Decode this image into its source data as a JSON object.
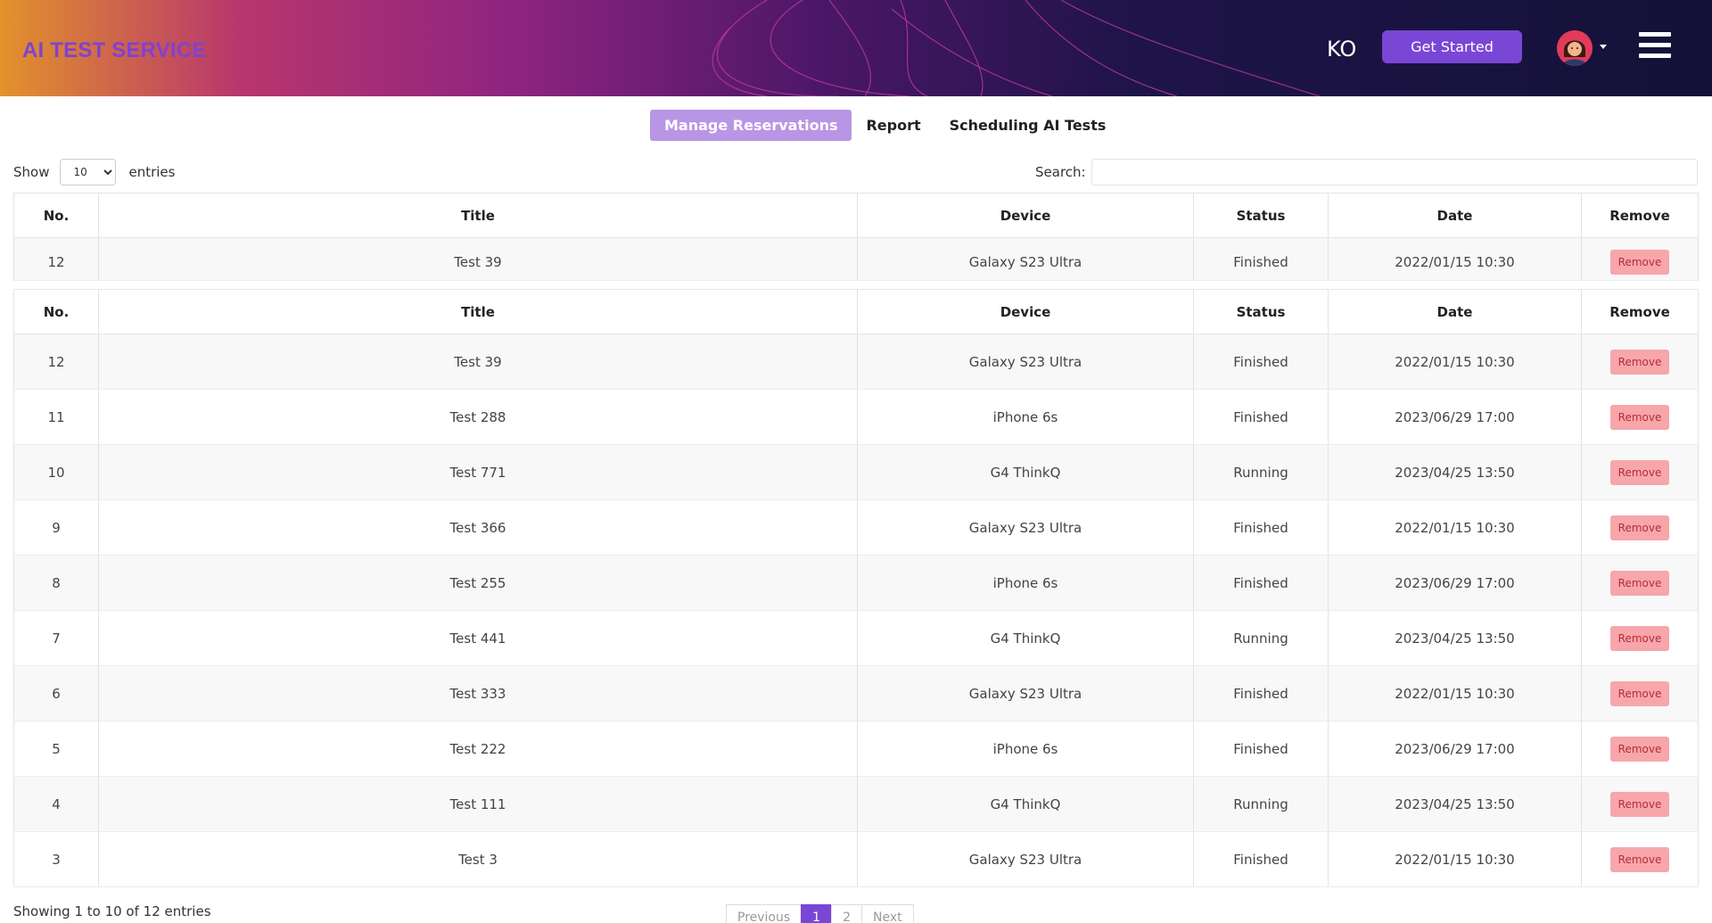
{
  "header": {
    "logo": "AI TEST SERVICE",
    "lang": "KO",
    "cta": "Get Started",
    "icons": {
      "avatar": "user-avatar-icon",
      "menu": "hamburger-menu-icon"
    }
  },
  "tabs": [
    {
      "label": "Manage Reservations",
      "active": true
    },
    {
      "label": "Report",
      "active": false
    },
    {
      "label": "Scheduling AI Tests",
      "active": false
    }
  ],
  "controls": {
    "show_label": "Show",
    "entries_label": "entries",
    "page_size": "10",
    "search_label": "Search:"
  },
  "table": {
    "columns": [
      "No.",
      "Title",
      "Device",
      "Status",
      "Date",
      "Remove"
    ],
    "remove_label": "Remove",
    "rows": [
      {
        "no": "12",
        "title": "Test 39",
        "device": "Galaxy S23 Ultra",
        "status": "Finished",
        "date": "2022/01/15 10:30"
      },
      {
        "no": "11",
        "title": "Test 288",
        "device": "iPhone 6s",
        "status": "Finished",
        "date": "2023/06/29 17:00"
      },
      {
        "no": "10",
        "title": "Test 771",
        "device": "G4 ThinkQ",
        "status": "Running",
        "date": "2023/04/25 13:50"
      },
      {
        "no": "9",
        "title": "Test 366",
        "device": "Galaxy S23 Ultra",
        "status": "Finished",
        "date": "2022/01/15 10:30"
      },
      {
        "no": "8",
        "title": "Test 255",
        "device": "iPhone 6s",
        "status": "Finished",
        "date": "2023/06/29 17:00"
      },
      {
        "no": "7",
        "title": "Test 441",
        "device": "G4 ThinkQ",
        "status": "Running",
        "date": "2023/04/25 13:50"
      },
      {
        "no": "6",
        "title": "Test 333",
        "device": "Galaxy S23 Ultra",
        "status": "Finished",
        "date": "2022/01/15 10:30"
      },
      {
        "no": "5",
        "title": "Test 222",
        "device": "iPhone 6s",
        "status": "Finished",
        "date": "2023/06/29 17:00"
      },
      {
        "no": "4",
        "title": "Test 111",
        "device": "G4 ThinkQ",
        "status": "Running",
        "date": "2023/04/25 13:50"
      },
      {
        "no": "3",
        "title": "Test 3",
        "device": "Galaxy S23 Ultra",
        "status": "Finished",
        "date": "2022/01/15 10:30"
      }
    ]
  },
  "footer": {
    "info": "Showing 1 to 10 of 12 entries",
    "pagination": {
      "previous": "Previous",
      "pages": [
        "1",
        "2"
      ],
      "current": "1",
      "next": "Next"
    }
  },
  "colors": {
    "accent": "#7a46d6",
    "tab_active": "#b995e6",
    "remove_bg": "#f7a6ab",
    "remove_text": "#b72c36"
  }
}
